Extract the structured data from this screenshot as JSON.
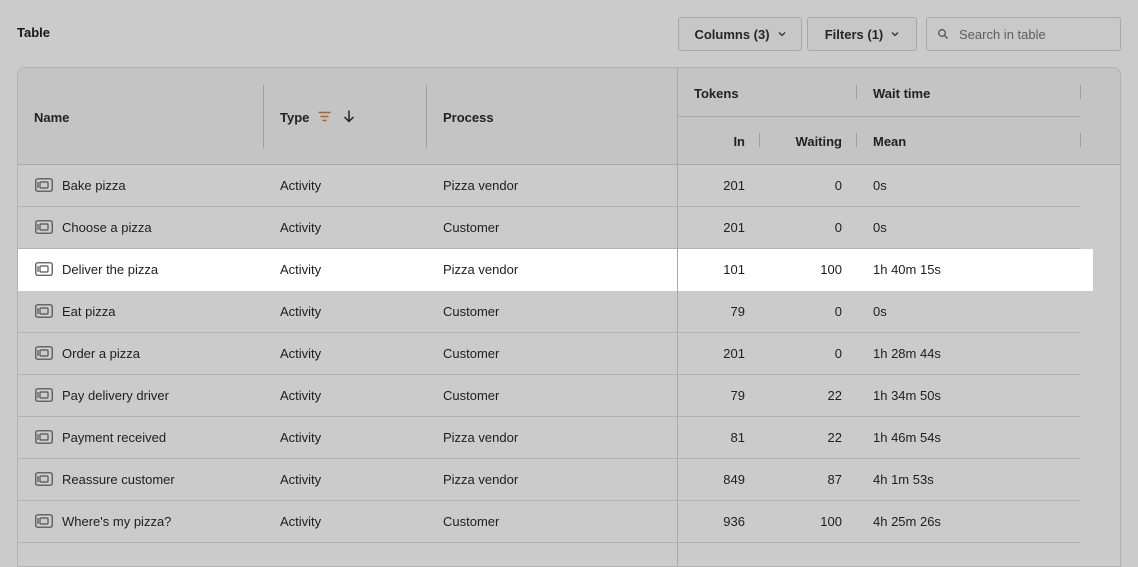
{
  "header": {
    "title": "Table",
    "columns_button": "Columns (3)",
    "filters_button": "Filters (1)",
    "search_placeholder": "Search in table"
  },
  "columns": {
    "name": "Name",
    "type": "Type",
    "process": "Process",
    "tokens_group": "Tokens",
    "wait_group": "Wait time",
    "in": "In",
    "waiting": "Waiting",
    "mean": "Mean"
  },
  "rows": [
    {
      "name": "Bake pizza",
      "type": "Activity",
      "process": "Pizza vendor",
      "in": "201",
      "waiting": "0",
      "mean": "0s"
    },
    {
      "name": "Choose a pizza",
      "type": "Activity",
      "process": "Customer",
      "in": "201",
      "waiting": "0",
      "mean": "0s"
    },
    {
      "name": "Deliver the pizza",
      "type": "Activity",
      "process": "Pizza vendor",
      "in": "101",
      "waiting": "100",
      "mean": "1h 40m 15s"
    },
    {
      "name": "Eat pizza",
      "type": "Activity",
      "process": "Customer",
      "in": "79",
      "waiting": "0",
      "mean": "0s"
    },
    {
      "name": "Order a pizza",
      "type": "Activity",
      "process": "Customer",
      "in": "201",
      "waiting": "0",
      "mean": "1h 28m 44s"
    },
    {
      "name": "Pay delivery driver",
      "type": "Activity",
      "process": "Customer",
      "in": "79",
      "waiting": "22",
      "mean": "1h 34m 50s"
    },
    {
      "name": "Payment received",
      "type": "Activity",
      "process": "Pizza vendor",
      "in": "81",
      "waiting": "22",
      "mean": "1h 46m 54s"
    },
    {
      "name": "Reassure customer",
      "type": "Activity",
      "process": "Pizza vendor",
      "in": "849",
      "waiting": "87",
      "mean": "4h 1m 53s"
    },
    {
      "name": "Where's my pizza?",
      "type": "Activity",
      "process": "Customer",
      "in": "936",
      "waiting": "100",
      "mean": "4h 25m 26s"
    }
  ],
  "icons": {
    "row": "activity-task-icon",
    "filter": "filter-lines-icon",
    "sort": "arrow-down-icon",
    "search": "search-icon",
    "dropdown": "chevron-down-icon"
  },
  "colors": {
    "filter_icon": "#b5611c",
    "highlight_row": "#ffffff",
    "background": "#cbcbcb"
  }
}
